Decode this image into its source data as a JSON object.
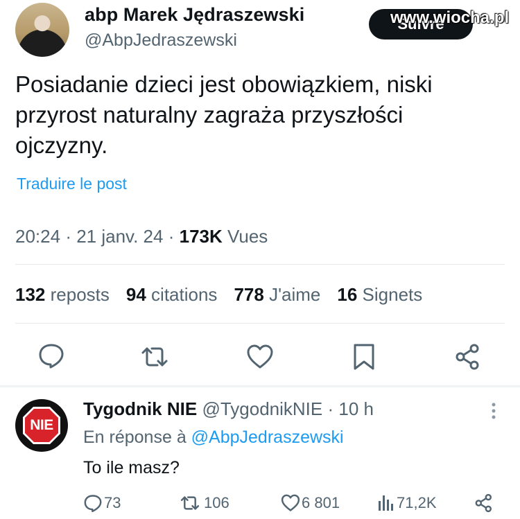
{
  "author": {
    "name": "abp Marek Jędraszewski",
    "handle": "@AbpJedraszewski",
    "follow_label": "Suivre"
  },
  "watermark": "www.wiocha.pl",
  "post": {
    "text": "Posiadanie dzieci jest obowiązkiem, niski przyrost naturalny zagraża przyszłości ojczyzny.",
    "translate_label": "Traduire le post",
    "time": "20:24",
    "date": "21 janv. 24",
    "views_count": "173K",
    "views_label": "Vues"
  },
  "stats": [
    {
      "count": "132",
      "label": "reposts"
    },
    {
      "count": "94",
      "label": "citations"
    },
    {
      "count": "778",
      "label": "J'aime"
    },
    {
      "count": "16",
      "label": "Signets"
    }
  ],
  "actions": [
    "reply-icon",
    "repost-icon",
    "like-icon",
    "bookmark-icon",
    "share-icon"
  ],
  "reply": {
    "avatar_text": "NIE",
    "name": "Tygodnik NIE",
    "handle": "@TygodnikNIE",
    "time": "10 h",
    "reply_prefix": "En réponse à",
    "reply_to": "@AbpJedraszewski",
    "text": "To ile masz?",
    "metrics": {
      "replies": "73",
      "reposts": "106",
      "likes": "6 801",
      "views": "71,2K"
    }
  },
  "colors": {
    "accent": "#1d9bf0",
    "muted": "#536471",
    "text": "#0f1419",
    "nie_red": "#d8232a"
  }
}
